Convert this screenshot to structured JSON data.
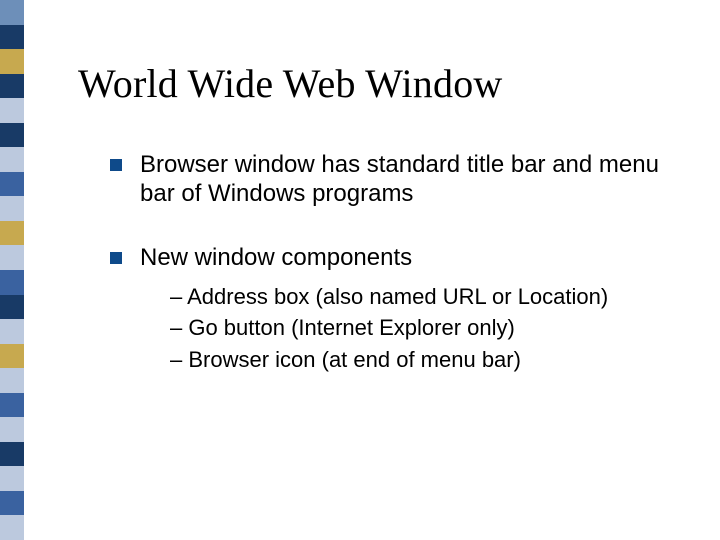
{
  "title": "World Wide Web Window",
  "bullets": [
    {
      "text": "Browser window has standard title bar and menu bar of Windows programs"
    },
    {
      "text": "New window components",
      "sub": [
        "– Address box (also named URL or Location)",
        "– Go button (Internet Explorer only)",
        "– Browser icon (at end of menu bar)"
      ]
    }
  ],
  "sidebar_colors": [
    "#6d8fb9",
    "#183a66",
    "#c7a94f",
    "#183a66",
    "#bcc9de",
    "#183a66",
    "#bcc9de",
    "#3a62a0",
    "#bcc9de",
    "#c7a94f",
    "#bcc9de",
    "#3a62a0",
    "#183a66",
    "#bcc9de",
    "#c7a94f",
    "#bcc9de",
    "#3a62a0",
    "#bcc9de",
    "#183a66",
    "#bcc9de",
    "#3a62a0",
    "#bcc9de"
  ]
}
